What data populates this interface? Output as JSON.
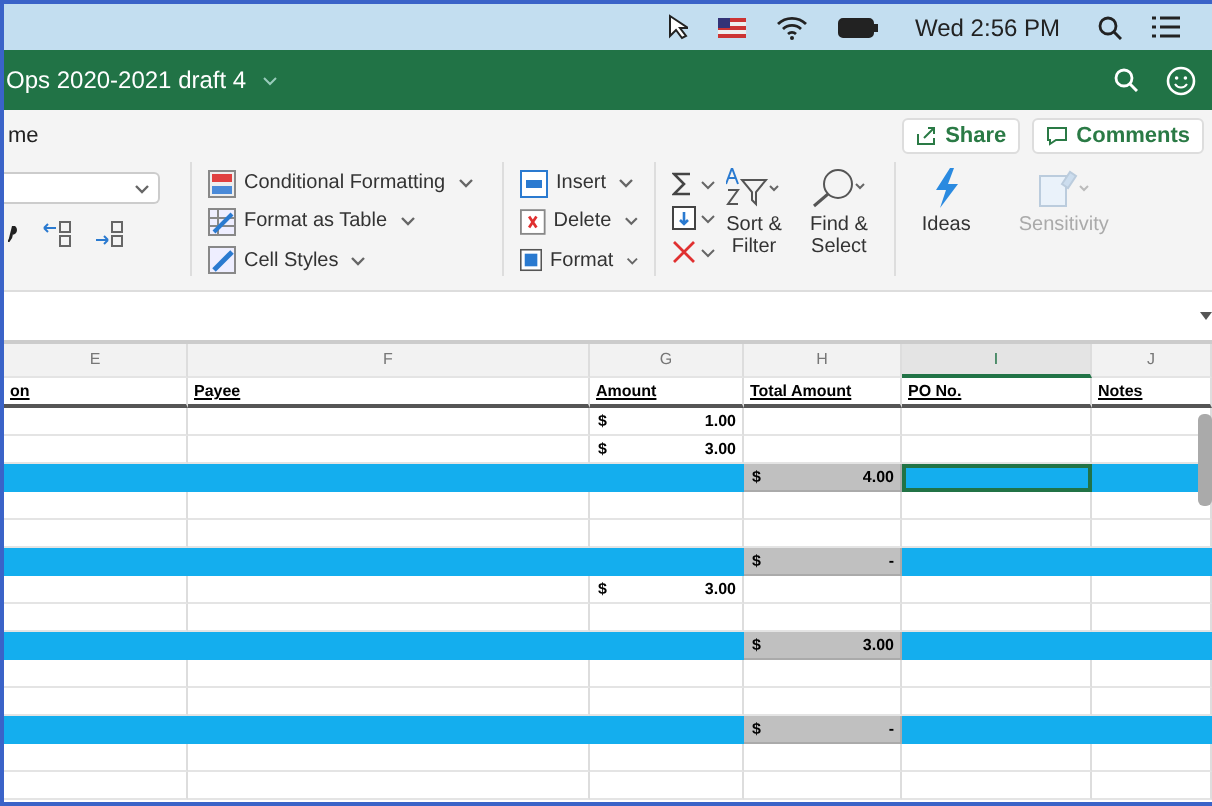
{
  "menu_bar": {
    "clock": "Wed 2:56 PM"
  },
  "title_bar": {
    "title": "Ops 2020-2021 draft 4"
  },
  "ribbon": {
    "tab": "me",
    "share": "Share",
    "comments": "Comments",
    "styles": [
      {
        "label": "Conditional Formatting"
      },
      {
        "label": "Format as Table"
      },
      {
        "label": "Cell Styles"
      }
    ],
    "cells": [
      {
        "label": "Insert"
      },
      {
        "label": "Delete"
      },
      {
        "label": "Format"
      }
    ],
    "editing": [
      {
        "label": "Sort &\nFilter"
      },
      {
        "label": "Find &\nSelect"
      }
    ],
    "ideas": [
      {
        "label": "Ideas",
        "disabled": false
      },
      {
        "label": "Sensitivity",
        "disabled": true
      }
    ]
  },
  "sheet": {
    "columns": [
      {
        "letter": "E",
        "header": "on",
        "selected": false
      },
      {
        "letter": "F",
        "header": "Payee",
        "selected": false
      },
      {
        "letter": "G",
        "header": "Amount",
        "selected": false
      },
      {
        "letter": "H",
        "header": "Total Amount",
        "selected": false
      },
      {
        "letter": "I",
        "header": "PO No.",
        "selected": true
      },
      {
        "letter": "J",
        "header": "Notes",
        "selected": false
      }
    ],
    "rows": [
      {
        "kind": "detail",
        "amount": {
          "currency": "$",
          "value": "1.00"
        },
        "selected": false
      },
      {
        "kind": "detail",
        "amount": {
          "currency": "$",
          "value": "3.00"
        },
        "selected": false
      },
      {
        "kind": "total",
        "total": {
          "currency": "$",
          "value": "4.00"
        },
        "selected": true
      },
      {
        "kind": "blank",
        "selected": false
      },
      {
        "kind": "blank",
        "selected": false
      },
      {
        "kind": "total",
        "total": {
          "currency": "$",
          "value": "-"
        },
        "selected": false
      },
      {
        "kind": "detail",
        "amount": {
          "currency": "$",
          "value": "3.00"
        },
        "selected": false
      },
      {
        "kind": "blank",
        "selected": false
      },
      {
        "kind": "total",
        "total": {
          "currency": "$",
          "value": "3.00"
        },
        "selected": false
      },
      {
        "kind": "blank",
        "selected": false
      },
      {
        "kind": "blank",
        "selected": false
      },
      {
        "kind": "total",
        "total": {
          "currency": "$",
          "value": "-"
        },
        "selected": false
      },
      {
        "kind": "blank",
        "selected": false
      },
      {
        "kind": "blank",
        "selected": false
      }
    ]
  }
}
